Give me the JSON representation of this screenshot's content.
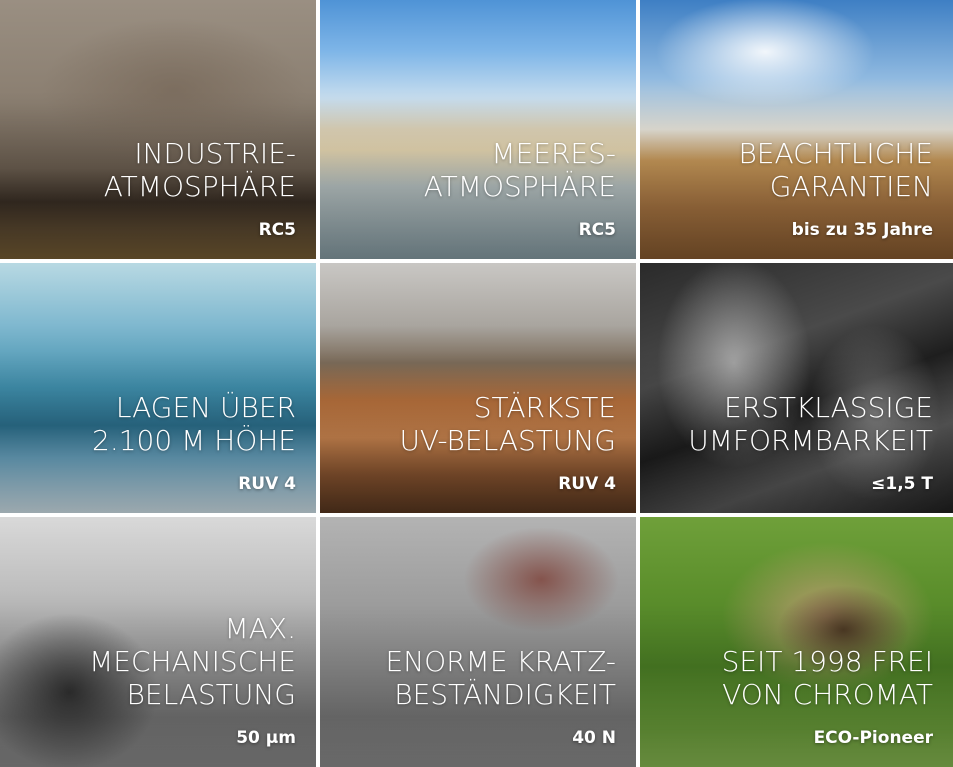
{
  "tiles": [
    {
      "caption_lines": [
        "INDUSTRIE-",
        "ATMOSPHÄRE"
      ],
      "value": "RC5",
      "image": "industry-smoke-image"
    },
    {
      "caption_lines": [
        "MEERES-",
        "ATMOSPHÄRE"
      ],
      "value": "RC5",
      "image": "coastal-skyline-image"
    },
    {
      "caption_lines": [
        "BEACHTLICHE",
        "GARANTIEN"
      ],
      "value": "bis zu 35 Jahre",
      "image": "pyramids-image"
    },
    {
      "caption_lines": [
        "LAGEN ÜBER",
        "2.100 M HÖHE"
      ],
      "value": "RUV 4",
      "image": "mountain-climber-image"
    },
    {
      "caption_lines": [
        "STÄRKSTE",
        "UV-BELASTUNG"
      ],
      "value": "RUV 4",
      "image": "desert-dune-image"
    },
    {
      "caption_lines": [
        "ERSTKLASSIGE",
        "UMFORMBARKEIT"
      ],
      "value": "≤1,5 T",
      "image": "steel-coil-image"
    },
    {
      "caption_lines": [
        "MAX.",
        "MECHANISCHE",
        "BELASTUNG"
      ],
      "value": "50 µm",
      "image": "car-tire-smoke-image"
    },
    {
      "caption_lines": [
        "ENORME KRATZ-",
        "BESTÄNDIGKEIT"
      ],
      "value": "40 N",
      "image": "snow-scratch-image"
    },
    {
      "caption_lines": [
        "SEIT 1998 FREI",
        "VON CHROMAT"
      ],
      "value": "ECO-Pioneer",
      "image": "hands-plant-image"
    }
  ]
}
